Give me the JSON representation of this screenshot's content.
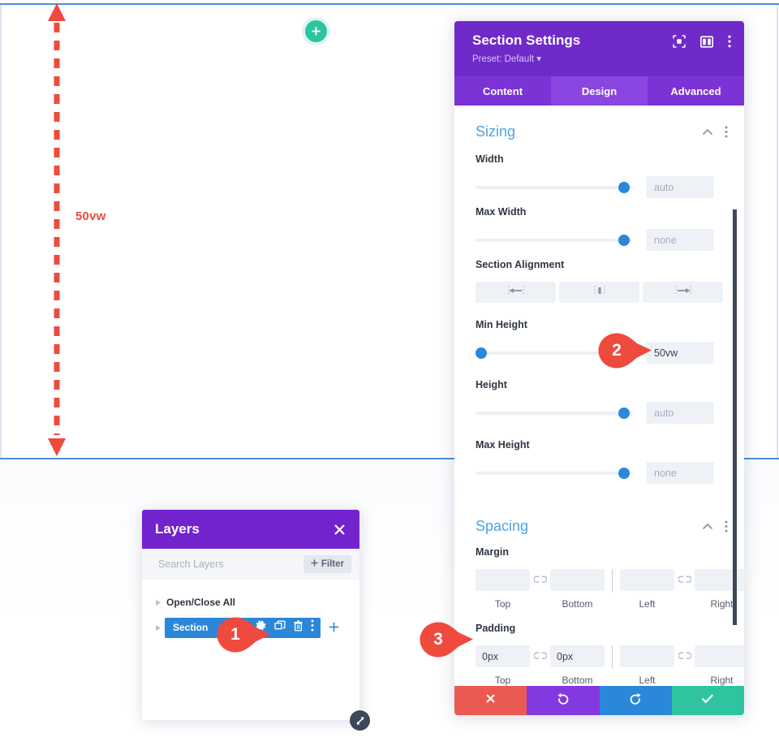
{
  "canvas": {
    "add_section_icon": "plus-icon",
    "measurement": {
      "label": "50vw",
      "color": "#ef4a3e",
      "style": "dashed-double-arrow-vertical"
    }
  },
  "callouts": [
    {
      "number": "1",
      "color": "#ef4a3e",
      "target": "layers-section-gear"
    },
    {
      "number": "2",
      "color": "#ef4a3e",
      "target": "min-height-value"
    },
    {
      "number": "3",
      "color": "#ef4a3e",
      "target": "padding-top-value"
    }
  ],
  "layers_panel": {
    "title": "Layers",
    "close_icon": "close-icon",
    "search": {
      "placeholder": "Search Layers",
      "value": ""
    },
    "filter_button": {
      "label": "Filter",
      "icon": "plus-icon"
    },
    "rows": [
      {
        "label": "Open/Close All",
        "caret": "caret-right-icon",
        "selected": false
      },
      {
        "label": "Section",
        "caret": "caret-right-icon",
        "selected": true
      }
    ],
    "row_actions": [
      "gear-icon",
      "duplicate-icon",
      "trash-icon",
      "more-vertical-icon"
    ],
    "add_layer_icon": "plus-icon",
    "resize_handle_icon": "resize-diagonal-icon",
    "accent_color": "#7323cd",
    "selected_row_color": "#2b87da"
  },
  "settings_panel": {
    "title": "Section Settings",
    "preset": "Preset: Default",
    "header_icons": [
      "focus-target-icon",
      "layout-columns-icon",
      "more-vertical-icon"
    ],
    "tabs": [
      {
        "label": "Content",
        "active": false
      },
      {
        "label": "Design",
        "active": true
      },
      {
        "label": "Advanced",
        "active": false
      }
    ],
    "groups": [
      {
        "title": "Sizing",
        "collapse_icon": "chevron-up-icon",
        "menu_icon": "more-vertical-icon",
        "fields": [
          {
            "type": "slider",
            "label": "Width",
            "value": "",
            "placeholder": "auto",
            "knob_pct": 91
          },
          {
            "type": "slider",
            "label": "Max Width",
            "value": "",
            "placeholder": "none",
            "knob_pct": 91
          },
          {
            "type": "align",
            "label": "Section Alignment",
            "options": [
              "align-left-icon",
              "align-center-icon",
              "align-right-icon"
            ]
          },
          {
            "type": "slider",
            "label": "Min Height",
            "value": "50vw",
            "placeholder": "",
            "knob_pct": 2
          },
          {
            "type": "slider",
            "label": "Height",
            "value": "",
            "placeholder": "auto",
            "knob_pct": 91
          },
          {
            "type": "slider",
            "label": "Max Height",
            "value": "",
            "placeholder": "none",
            "knob_pct": 91
          }
        ]
      },
      {
        "title": "Spacing",
        "collapse_icon": "chevron-up-icon",
        "menu_icon": "more-vertical-icon",
        "fields": [
          {
            "type": "spacing",
            "label": "Margin",
            "link_icon": "link-icon",
            "cells": [
              {
                "name": "Top",
                "value": "",
                "placeholder": ""
              },
              {
                "name": "Bottom",
                "value": "",
                "placeholder": ""
              },
              {
                "name": "Left",
                "value": "",
                "placeholder": ""
              },
              {
                "name": "Right",
                "value": "",
                "placeholder": ""
              }
            ]
          },
          {
            "type": "spacing",
            "label": "Padding",
            "link_icon": "link-icon",
            "cells": [
              {
                "name": "Top",
                "value": "0px",
                "placeholder": ""
              },
              {
                "name": "Bottom",
                "value": "0px",
                "placeholder": ""
              },
              {
                "name": "Left",
                "value": "",
                "placeholder": ""
              },
              {
                "name": "Right",
                "value": "",
                "placeholder": ""
              }
            ]
          }
        ]
      }
    ],
    "footer_buttons": [
      {
        "name": "cancel",
        "icon": "x-icon",
        "color": "#ea5a52"
      },
      {
        "name": "undo",
        "icon": "undo-icon",
        "color": "#8338e0"
      },
      {
        "name": "redo",
        "icon": "redo-icon",
        "color": "#2b87da"
      },
      {
        "name": "save",
        "icon": "check-icon",
        "color": "#2ec4a0"
      }
    ],
    "header_color": "#6f2ac9",
    "tabbar_color": "#7b33d6",
    "group_title_color": "#4fa3e3"
  }
}
